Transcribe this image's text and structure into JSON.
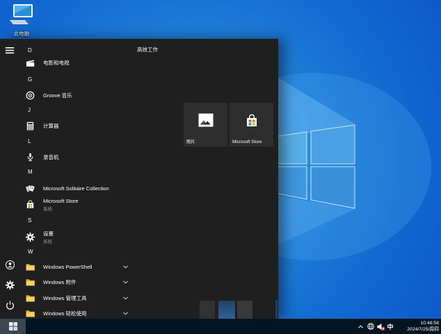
{
  "desktop": {
    "this_pc_label": "此电脑"
  },
  "start_menu": {
    "group_header": "高效工作",
    "app_list": [
      {
        "kind": "letter",
        "label": "D"
      },
      {
        "kind": "app",
        "label": "电影和电视",
        "icon": "movies-tv-icon"
      },
      {
        "kind": "letter",
        "label": "G"
      },
      {
        "kind": "app",
        "label": "Groove 音乐",
        "icon": "groove-music-icon"
      },
      {
        "kind": "letter",
        "label": "J"
      },
      {
        "kind": "app",
        "label": "计算器",
        "icon": "calculator-icon"
      },
      {
        "kind": "letter",
        "label": "L"
      },
      {
        "kind": "app",
        "label": "录音机",
        "icon": "voice-recorder-icon"
      },
      {
        "kind": "letter",
        "label": "M"
      },
      {
        "kind": "app",
        "label": "Microsoft Solitaire Collection",
        "icon": "solitaire-icon"
      },
      {
        "kind": "app",
        "label": "Microsoft Store",
        "sublabel": "系统",
        "icon": "store-icon"
      },
      {
        "kind": "letter",
        "label": "S"
      },
      {
        "kind": "app",
        "label": "设置",
        "sublabel": "系统",
        "icon": "settings-gear-icon"
      },
      {
        "kind": "letter",
        "label": "W"
      },
      {
        "kind": "folder",
        "label": "Windows PowerShell",
        "icon": "folder-icon"
      },
      {
        "kind": "folder",
        "label": "Windows 附件",
        "icon": "folder-icon"
      },
      {
        "kind": "folder",
        "label": "Windows 管理工具",
        "icon": "folder-icon"
      },
      {
        "kind": "folder",
        "label": "Windows 轻松使用",
        "icon": "folder-icon"
      }
    ],
    "tiles": [
      {
        "label": "照片",
        "icon": "photos-icon"
      },
      {
        "label": "Microsoft Store",
        "icon": "store-icon"
      }
    ],
    "rail_icons": [
      "hamburger-icon",
      "user-icon",
      "settings-gear-icon",
      "power-icon"
    ]
  },
  "taskbar": {
    "ime_indicator": "中",
    "clock": {
      "time": "10:48:58",
      "date": "2024/7/25/周四"
    },
    "tray_icons": [
      "chevron-up-icon",
      "network-globe-icon",
      "speaker-muted-icon"
    ]
  },
  "colors": {
    "wallpaper_deep": "#0b46c4",
    "wallpaper_light": "#2e9ae2",
    "logo_pane": "#4ba6e4",
    "menu_bg": "#1f1f1f",
    "tile_bg": "#2e2e2e",
    "taskbar_bg": "#041521",
    "start_button_bg": "#3a4650",
    "folder_yellow": "#ffd05e",
    "store_red": "#f25022",
    "store_green": "#7fba00",
    "store_blue": "#00a4ef",
    "store_yellow": "#ffb900",
    "mute_badge_red": "#e03c31"
  }
}
